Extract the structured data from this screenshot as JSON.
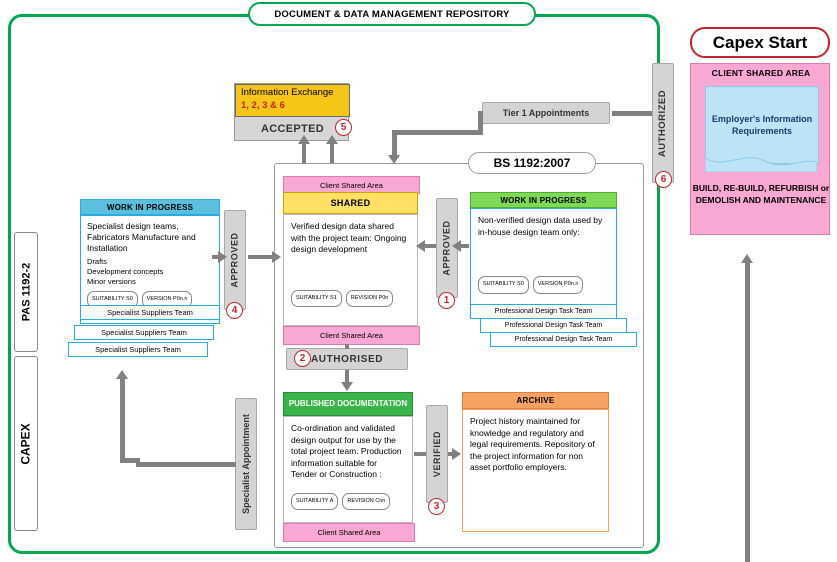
{
  "diagram": {
    "repository_title": "DOCUMENT & DATA MANAGEMENT REPOSITORY",
    "bs_standard_label": "BS 1192:2007",
    "left_bars": {
      "pas": "PAS 1192-2",
      "capex": "CAPEX"
    },
    "capex_start": "Capex Start",
    "information_exchange": {
      "title": "Information Exchange",
      "numbers": "1, 2, 3 & 6",
      "status": "ACCEPTED",
      "marker": "5"
    },
    "gates": {
      "approved_left": "APPROVED",
      "approved_left_marker": "4",
      "approved_right": "APPROVED",
      "approved_right_marker": "1",
      "authorised": "AUTHORISED",
      "authorised_marker": "2",
      "verified": "VERIFIED",
      "verified_marker": "3",
      "authorized_right": "AUTHORIZED",
      "authorized_right_marker": "6",
      "tier1": "Tier 1 Appointments",
      "specialist_appointment": "Specialist Appointment"
    },
    "shared": {
      "top_strip": "Client Shared Area",
      "header": "SHARED",
      "body": "Verified design data shared with the project team: Ongoing design development",
      "chips": [
        "SUITABILITY S1",
        "REVISION P0n"
      ],
      "bottom_strip": "Client Shared Area"
    },
    "wip_right": {
      "header": "WORK IN PROGRESS",
      "body": "Non-verified design data used by in-house design team only:",
      "chips": [
        "SUITABILITY S0",
        "VERSION P0n.n"
      ],
      "tabs": [
        "Professional Design Task Team",
        "Professional Design Task Team",
        "Professional Design Task Team"
      ]
    },
    "wip_left": {
      "header": "WORK IN PROGRESS",
      "body_main": "Specialist design teams, Fabricators Manufacture and Installation",
      "body_sub": [
        "Drafts",
        "Development concepts",
        "Minor versions"
      ],
      "chips": [
        "SUITABILITY S0",
        "VERSION P0n.n"
      ],
      "tabs": [
        "Specialist Suppliers Team",
        "Specialist Suppliers Team",
        "Specialist Suppliers Team"
      ]
    },
    "published": {
      "header": "PUBLISHED DOCUMENTATION",
      "body": "Co-ordination and validated design output for use by the total project team. Production information suitable for Tender or Construction :",
      "chips": [
        "SUITABILITY A",
        "REVISION Cnn"
      ],
      "bottom_strip": "Client Shared Area"
    },
    "archive": {
      "header": "ARCHIVE",
      "body": "Project history maintained for knowledge and regulatory and legal requirements. Repository of the project information for non asset portfolio employers."
    },
    "client_shared_area": {
      "title": "CLIENT SHARED AREA",
      "eir": "Employer's Information Requirements",
      "footer": "BUILD, RE-BUILD, REFURBISH or DEMOLISH AND MAINTENANCE"
    },
    "colors": {
      "frame_green": "#00A651",
      "capex_red": "#C1272D",
      "pink": "#F9A8D4",
      "yellow": "#FFE066",
      "blue": "#29ABE2",
      "green": "#39B54A",
      "orange": "#F4A261",
      "grey": "#808080"
    }
  }
}
